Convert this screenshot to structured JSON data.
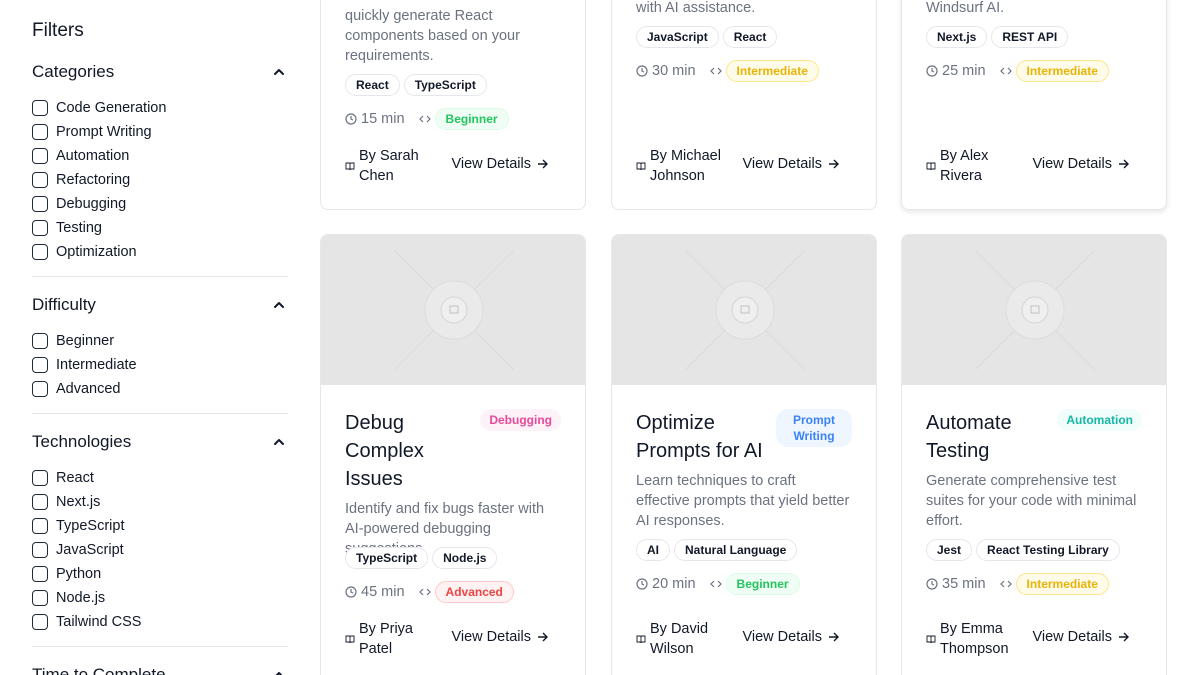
{
  "sidebar": {
    "title": "Filters",
    "categories": {
      "title": "Categories",
      "options": [
        "Code Generation",
        "Prompt Writing",
        "Automation",
        "Refactoring",
        "Debugging",
        "Testing",
        "Optimization"
      ]
    },
    "difficulty": {
      "title": "Difficulty",
      "options": [
        "Beginner",
        "Intermediate",
        "Advanced"
      ]
    },
    "technologies": {
      "title": "Technologies",
      "options": [
        "React",
        "Next.js",
        "TypeScript",
        "JavaScript",
        "Python",
        "Node.js",
        "Tailwind CSS"
      ]
    },
    "time": {
      "title": "Time to Complete"
    }
  },
  "cards": [
    {
      "description": "quickly generate React components based on your requirements.",
      "tags": [
        "React",
        "TypeScript"
      ],
      "time": "15 min",
      "difficulty": "Beginner",
      "author": "By Sarah Chen",
      "view": "View Details"
    },
    {
      "description": "with AI assistance.",
      "tags": [
        "JavaScript",
        "React"
      ],
      "time": "30 min",
      "difficulty": "Intermediate",
      "author": "By Michael Johnson",
      "view": "View Details"
    },
    {
      "description": "Windsurf AI.",
      "tags": [
        "Next.js",
        "REST API"
      ],
      "time": "25 min",
      "difficulty": "Intermediate",
      "author": "By Alex Rivera",
      "view": "View Details"
    },
    {
      "title": "Debug Complex Issues",
      "category": "Debugging",
      "description": "Identify and fix bugs faster with AI-powered debugging suggestions.",
      "tags": [
        "TypeScript",
        "Node.js"
      ],
      "time": "45 min",
      "difficulty": "Advanced",
      "author": "By Priya Patel",
      "view": "View Details"
    },
    {
      "title": "Optimize Prompts for AI",
      "category": "Prompt Writing",
      "description": "Learn techniques to craft effective prompts that yield better AI responses.",
      "tags": [
        "AI",
        "Natural Language"
      ],
      "time": "20 min",
      "difficulty": "Beginner",
      "author": "By David Wilson",
      "view": "View Details"
    },
    {
      "title": "Automate Testing",
      "category": "Automation",
      "description": "Generate comprehensive test suites for your code with minimal effort.",
      "tags": [
        "Jest",
        "React Testing Library"
      ],
      "time": "35 min",
      "difficulty": "Intermediate",
      "author": "By Emma Thompson",
      "view": "View Details"
    }
  ],
  "colors": {
    "debugging_badge_bg": "#fdf2f8",
    "debugging_badge_text": "#ec4899",
    "prompt_badge_bg": "#eff6ff",
    "prompt_badge_text": "#3b82f6",
    "automation_badge_bg": "#f0fdfa",
    "automation_badge_text": "#14b8a6",
    "thumbnail_bg": "#e5e5e5"
  },
  "icons": {
    "clock": "clock-icon",
    "code": "code-icon",
    "book": "book-icon",
    "arrow": "arrow-right-icon",
    "chevron": "chevron-up-icon",
    "image": "image-placeholder-icon"
  }
}
